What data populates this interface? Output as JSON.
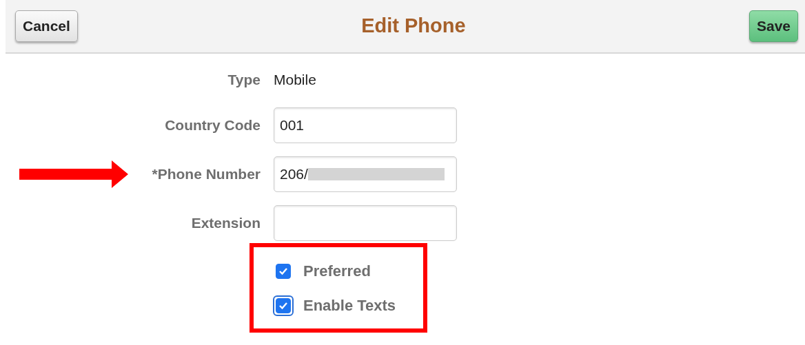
{
  "header": {
    "cancel": "Cancel",
    "title": "Edit Phone",
    "save": "Save"
  },
  "fields": [
    {
      "kind": "static",
      "label": "Type",
      "value": "Mobile"
    },
    {
      "kind": "input",
      "label": "Country Code",
      "value": "001"
    },
    {
      "kind": "input",
      "label": "*Phone Number",
      "value": "206/",
      "redacted": true,
      "highlighted": true
    },
    {
      "kind": "input",
      "label": "Extension"
    }
  ],
  "checkboxes": [
    {
      "label": "Preferred",
      "checked": true,
      "focused": false
    },
    {
      "label": "Enable Texts",
      "checked": true,
      "focused": true
    }
  ]
}
